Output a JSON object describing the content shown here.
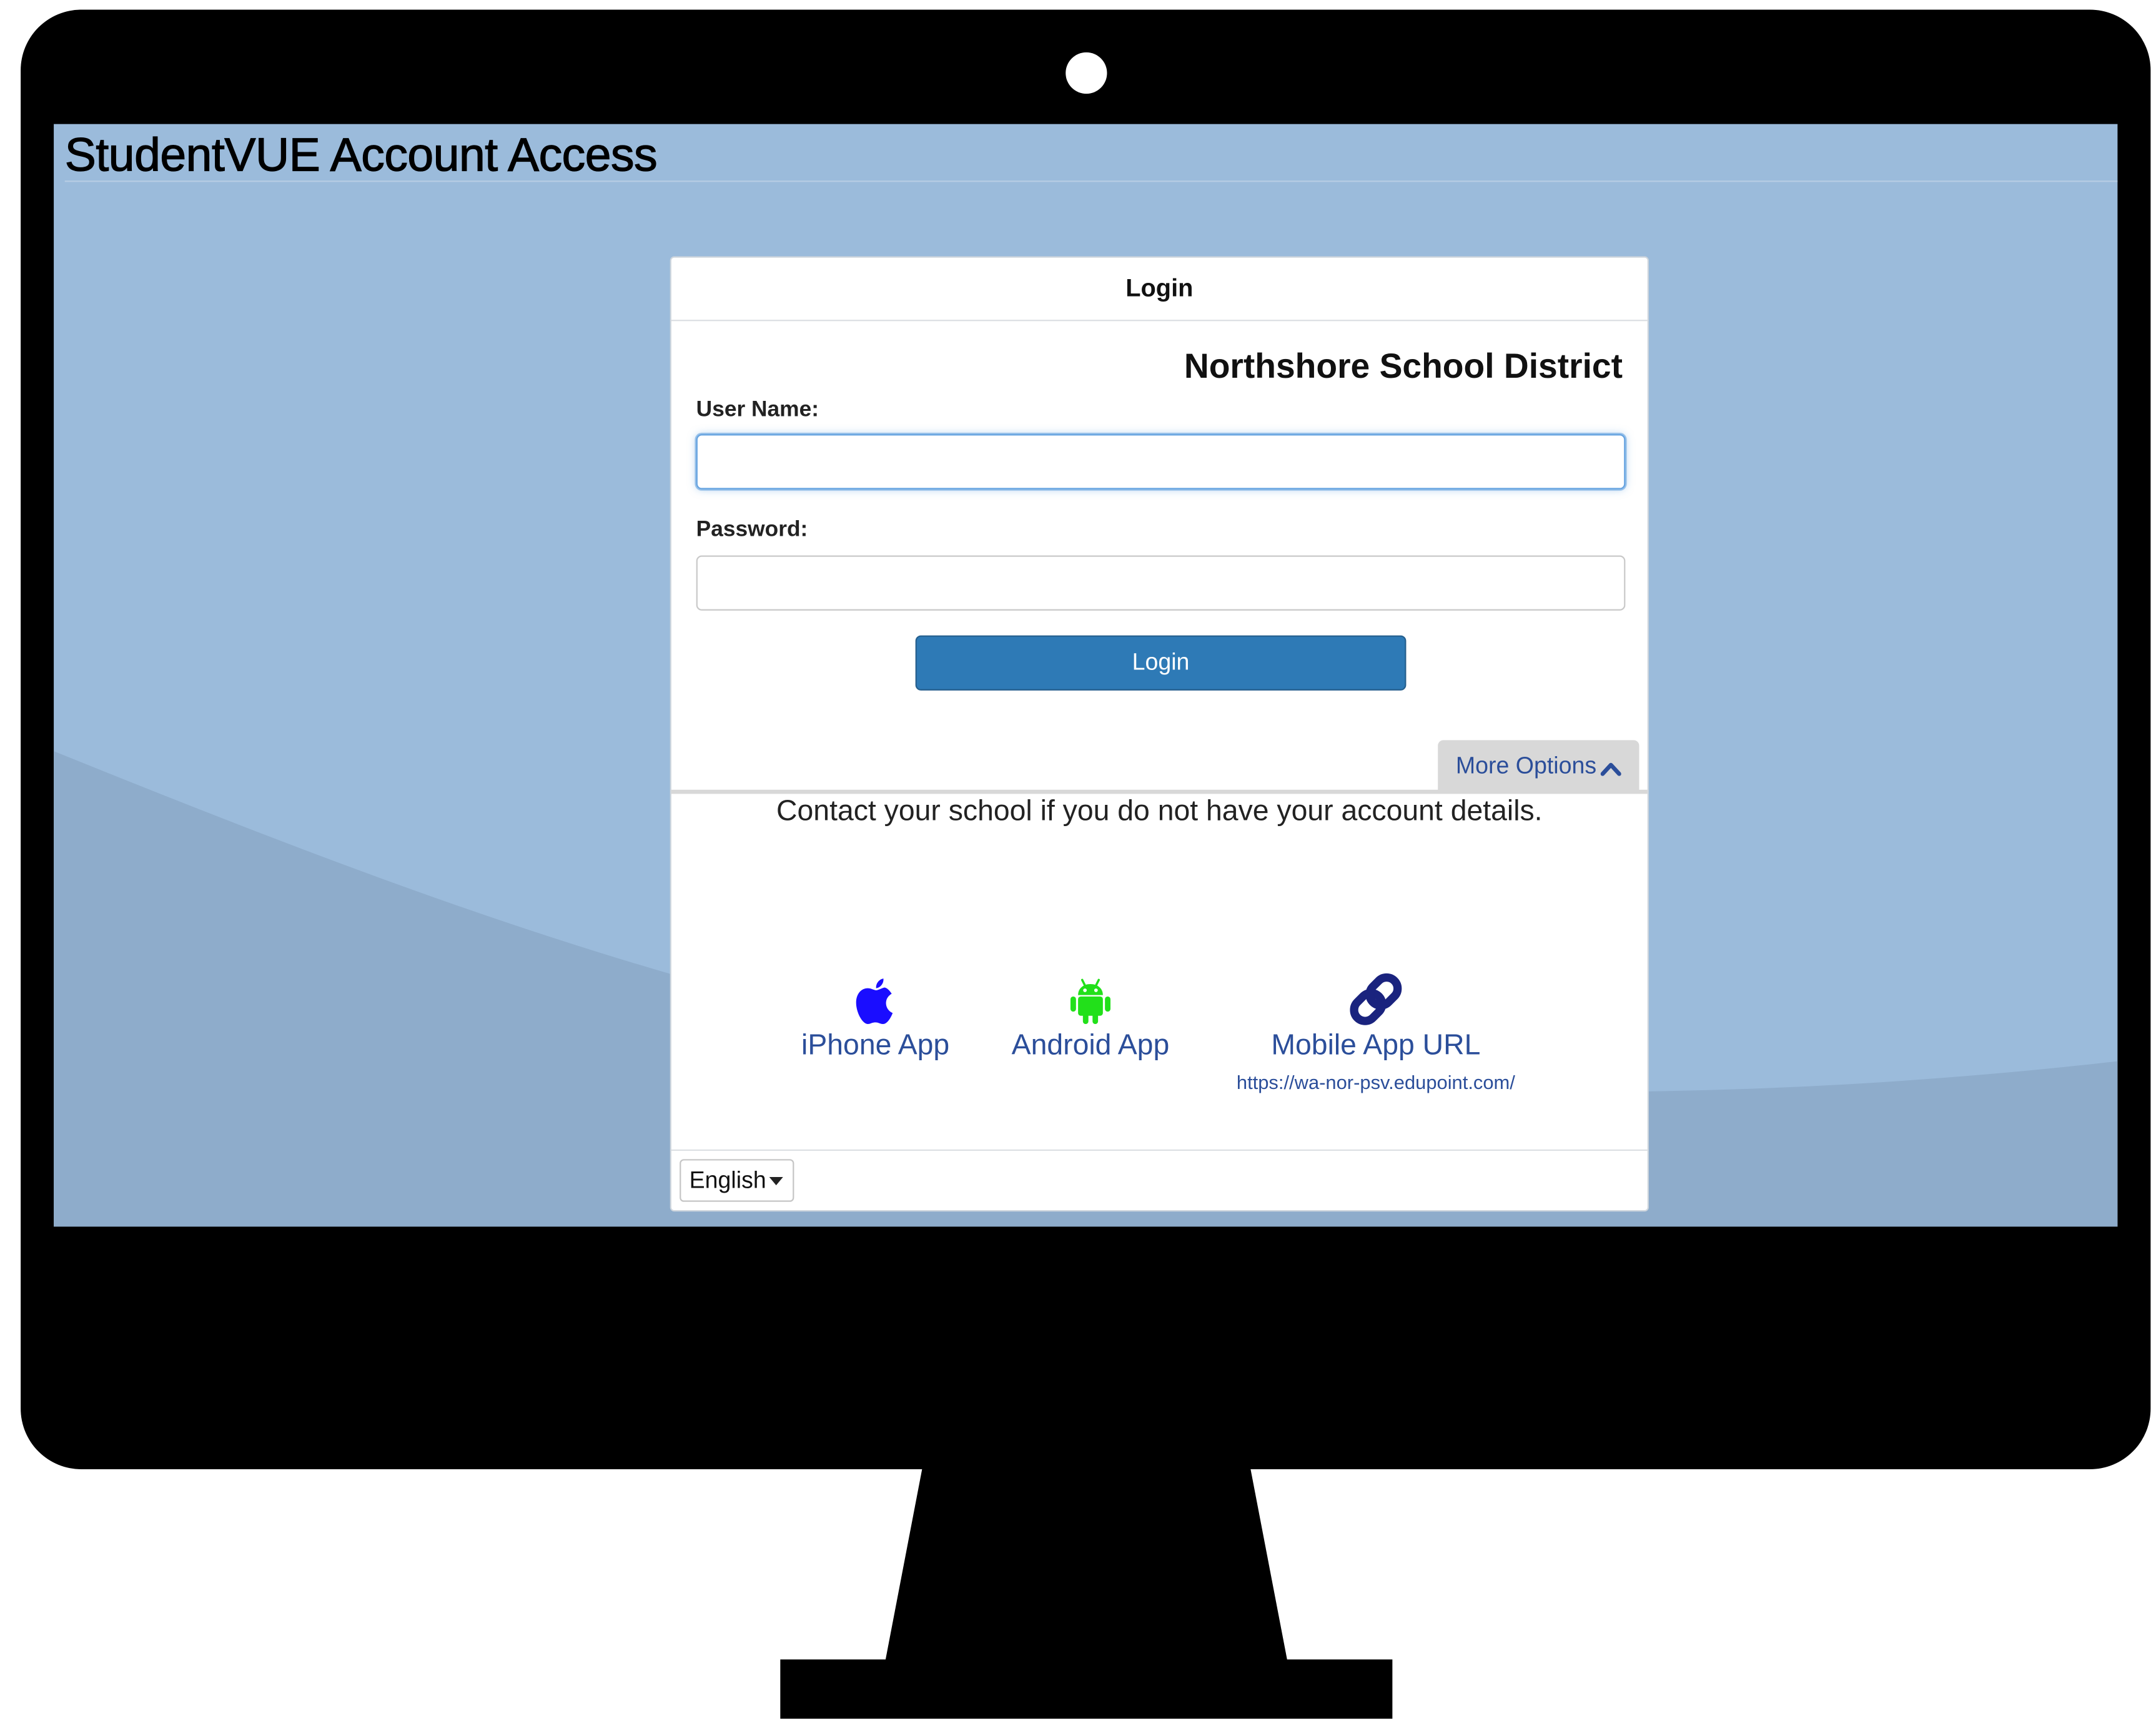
{
  "page": {
    "title": "StudentVUE Account Access"
  },
  "card": {
    "header": "Login",
    "district": "Northshore School District",
    "username_label": "User Name:",
    "username_value": "",
    "password_label": "Password:",
    "password_value": "",
    "login_button": "Login",
    "more_options": "More Options",
    "contact_text": "Contact your school if you do not have your account details."
  },
  "apps": {
    "iphone": {
      "label": "iPhone App",
      "icon": "apple-icon",
      "color": "#1a0dff"
    },
    "android": {
      "label": "Android App",
      "icon": "android-icon",
      "color": "#22e01a"
    },
    "url": {
      "label": "Mobile App URL",
      "sub": "https://wa-nor-psv.edupoint.com/",
      "icon": "link-icon",
      "color": "#1a237e"
    }
  },
  "language": {
    "selected": "English"
  },
  "colors": {
    "screen_bg": "#9bbbdb",
    "login_button": "#2e7ab6",
    "link_text": "#2b4e9a"
  }
}
